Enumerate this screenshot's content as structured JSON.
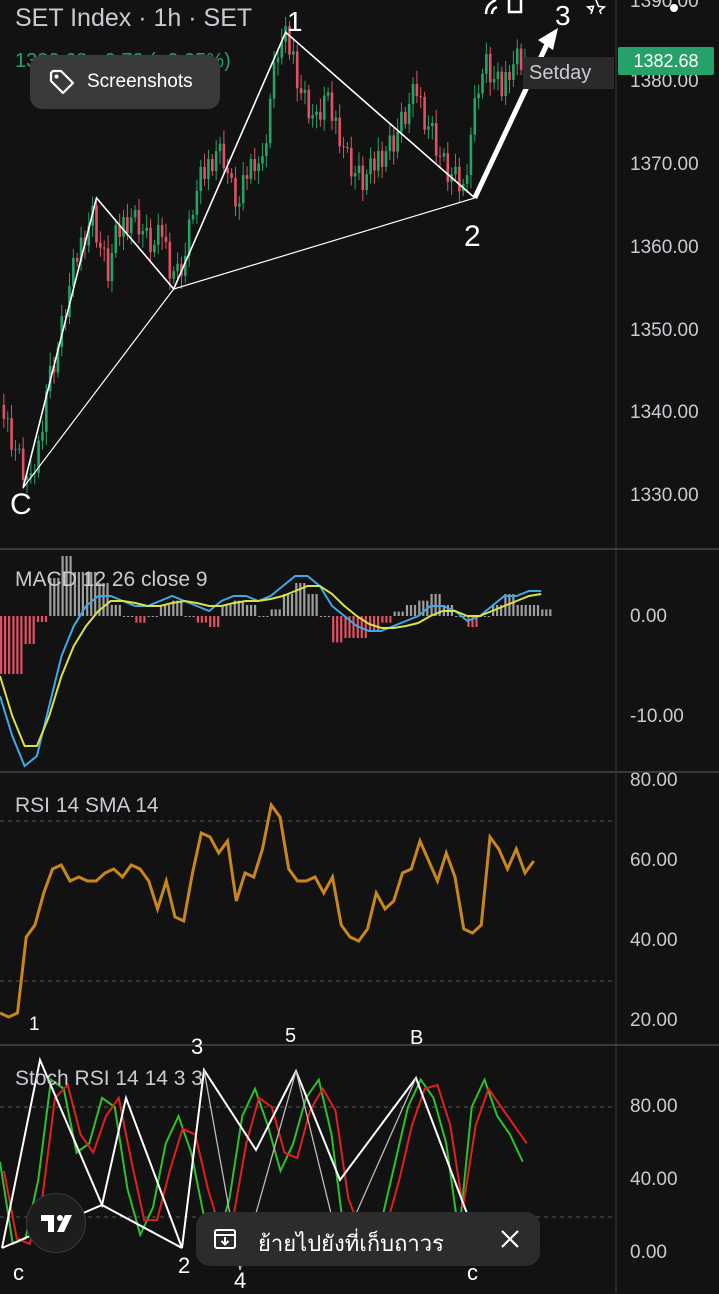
{
  "header": {
    "title": "SET Index · 1h · SET",
    "change_text": "1382.68 +0.72 (+0.05%)",
    "last_price": "1382.68",
    "setday_label": "Setday",
    "top_right_axis_value": "1390.00"
  },
  "chip": {
    "label": "Screenshots",
    "icon": "tag-icon"
  },
  "toast": {
    "message": "ย้ายไปยังที่เก็บถาวร",
    "icon": "archive-icon",
    "close_icon": "close-icon"
  },
  "wave_labels": {
    "price": {
      "c": "C",
      "w1": "1",
      "w2": "2",
      "w3": "3"
    },
    "stoch": {
      "s1": "1",
      "s2": "2",
      "s3": "3",
      "s4": "4",
      "s5": "5",
      "b": "B",
      "c1": "c",
      "c2": "c"
    }
  },
  "colors": {
    "background": "#121212",
    "up": "#26a269",
    "down": "#e05263",
    "macd": "#3fa9e8",
    "signal": "#d8e04a",
    "rsi": "#c8861e",
    "stoch_k": "#2ec02e",
    "stoch_d": "#e02020",
    "drawing": "#ffffff"
  },
  "chart_data": [
    {
      "type": "candlestick",
      "title": "SET Index · 1h · SET",
      "ylim": [
        1325,
        1392
      ],
      "y_ticks": [
        "1330.00",
        "1340.00",
        "1350.00",
        "1360.00",
        "1370.00",
        "1380.00"
      ],
      "close_path": [
        [
          0,
          1341
        ],
        [
          3,
          1337
        ],
        [
          6,
          1333
        ],
        [
          8,
          1331
        ],
        [
          10,
          1336
        ],
        [
          12,
          1343
        ],
        [
          15,
          1348
        ],
        [
          18,
          1355
        ],
        [
          20,
          1359
        ],
        [
          22,
          1362
        ],
        [
          24,
          1364
        ],
        [
          26,
          1360
        ],
        [
          28,
          1357
        ],
        [
          30,
          1361
        ],
        [
          32,
          1363
        ],
        [
          34,
          1364
        ],
        [
          36,
          1363
        ],
        [
          38,
          1361
        ],
        [
          40,
          1360
        ],
        [
          42,
          1362
        ],
        [
          44,
          1358
        ],
        [
          46,
          1357
        ],
        [
          48,
          1359
        ],
        [
          50,
          1365
        ],
        [
          52,
          1368
        ],
        [
          54,
          1370
        ],
        [
          56,
          1372
        ],
        [
          58,
          1371
        ],
        [
          60,
          1367
        ],
        [
          62,
          1365
        ],
        [
          64,
          1369
        ],
        [
          66,
          1371
        ],
        [
          68,
          1370
        ],
        [
          70,
          1378
        ],
        [
          72,
          1384
        ],
        [
          74,
          1385
        ],
        [
          76,
          1383
        ],
        [
          78,
          1379
        ],
        [
          80,
          1377
        ],
        [
          82,
          1375
        ],
        [
          84,
          1378
        ],
        [
          86,
          1376
        ],
        [
          88,
          1374
        ],
        [
          90,
          1371
        ],
        [
          92,
          1369
        ],
        [
          94,
          1368
        ],
        [
          96,
          1369
        ],
        [
          98,
          1371
        ],
        [
          100,
          1372
        ],
        [
          102,
          1373
        ],
        [
          104,
          1375
        ],
        [
          106,
          1377
        ],
        [
          108,
          1379
        ],
        [
          110,
          1376
        ],
        [
          112,
          1374
        ],
        [
          114,
          1371
        ],
        [
          116,
          1369
        ],
        [
          118,
          1368
        ],
        [
          120,
          1367
        ],
        [
          122,
          1374
        ],
        [
          124,
          1380
        ],
        [
          126,
          1382
        ],
        [
          128,
          1380
        ],
        [
          130,
          1379
        ],
        [
          132,
          1382
        ],
        [
          134,
          1383
        ],
        [
          136,
          1382.68
        ]
      ],
      "wave_points": [
        {
          "label": "C",
          "bar": 6,
          "price": 1331
        },
        {
          "label": "",
          "bar": 25,
          "price": 1366
        },
        {
          "label": "",
          "bar": 45,
          "price": 1355
        },
        {
          "label": "1",
          "bar": 74,
          "price": 1386
        },
        {
          "label": "2",
          "bar": 123,
          "price": 1366
        },
        {
          "label": "3",
          "bar": 145,
          "price": 1391
        }
      ]
    },
    {
      "type": "line",
      "title": "MACD 12 26 close 9",
      "ylim": [
        -16,
        5
      ],
      "y_ticks": [
        "0.00",
        "-10.00"
      ],
      "series": [
        {
          "values": [
            -8,
            -12,
            -15,
            -14,
            -9,
            -4,
            -1,
            1,
            2,
            2,
            1.5,
            1,
            1,
            1.5,
            2,
            1.5,
            1,
            0.5,
            1.5,
            2,
            2,
            1.5,
            2,
            3,
            4,
            4,
            3,
            1,
            0,
            -1,
            -1.5,
            -1.5,
            -1,
            -0.5,
            0,
            1,
            1,
            0.5,
            -0.5,
            0,
            1,
            2,
            2,
            2.5,
            2.5
          ]
        },
        {
          "values": [
            -6,
            -10,
            -13,
            -13,
            -10,
            -6,
            -3,
            -1,
            0.5,
            1.5,
            1.5,
            1.3,
            1,
            1,
            1.3,
            1.5,
            1.3,
            1,
            1,
            1.3,
            1.5,
            1.5,
            1.7,
            2,
            2.5,
            3,
            3,
            2.2,
            1,
            0,
            -0.8,
            -1.2,
            -1.2,
            -1,
            -0.7,
            0,
            0.5,
            0.5,
            0,
            0,
            0.5,
            1,
            1.5,
            2,
            2.2
          ]
        }
      ]
    },
    {
      "type": "line",
      "title": "RSI 14 SMA 14",
      "ylim": [
        15,
        82
      ],
      "y_ticks": [
        "80.00",
        "60.00",
        "40.00",
        "20.00"
      ],
      "series": [
        {
          "values": [
            22,
            21,
            22,
            41,
            44,
            52,
            58,
            59,
            55,
            56,
            55,
            55,
            57,
            58,
            56,
            59,
            58,
            55,
            48,
            55,
            46,
            45,
            57,
            67,
            66,
            62,
            65,
            50,
            57,
            56,
            63,
            74,
            71,
            58,
            55,
            55,
            56,
            52,
            56,
            44,
            41,
            40,
            43,
            52,
            48,
            50,
            57,
            58,
            65,
            60,
            55,
            62,
            56,
            43,
            42,
            44,
            66,
            63,
            58,
            63,
            57,
            60
          ]
        }
      ]
    },
    {
      "type": "line",
      "title": "Stoch RSI 14 14 3 3",
      "ylim": [
        -5,
        105
      ],
      "y_ticks": [
        "80.00",
        "40.00",
        "0.00"
      ],
      "series": [
        {
          "values": [
            50,
            5,
            8,
            40,
            95,
            90,
            55,
            60,
            85,
            80,
            35,
            10,
            25,
            60,
            75,
            55,
            20,
            5,
            30,
            75,
            90,
            70,
            45,
            60,
            85,
            95,
            65,
            10,
            15,
            5,
            20,
            50,
            80,
            95,
            85,
            60,
            10,
            80,
            95,
            75,
            65,
            50
          ]
        },
        {
          "values": [
            45,
            8,
            5,
            30,
            85,
            92,
            65,
            55,
            75,
            85,
            50,
            18,
            18,
            45,
            68,
            65,
            35,
            12,
            20,
            60,
            85,
            80,
            55,
            52,
            78,
            90,
            78,
            30,
            12,
            8,
            15,
            40,
            70,
            90,
            92,
            70,
            25,
            70,
            90,
            80,
            70,
            60
          ]
        }
      ]
    }
  ]
}
